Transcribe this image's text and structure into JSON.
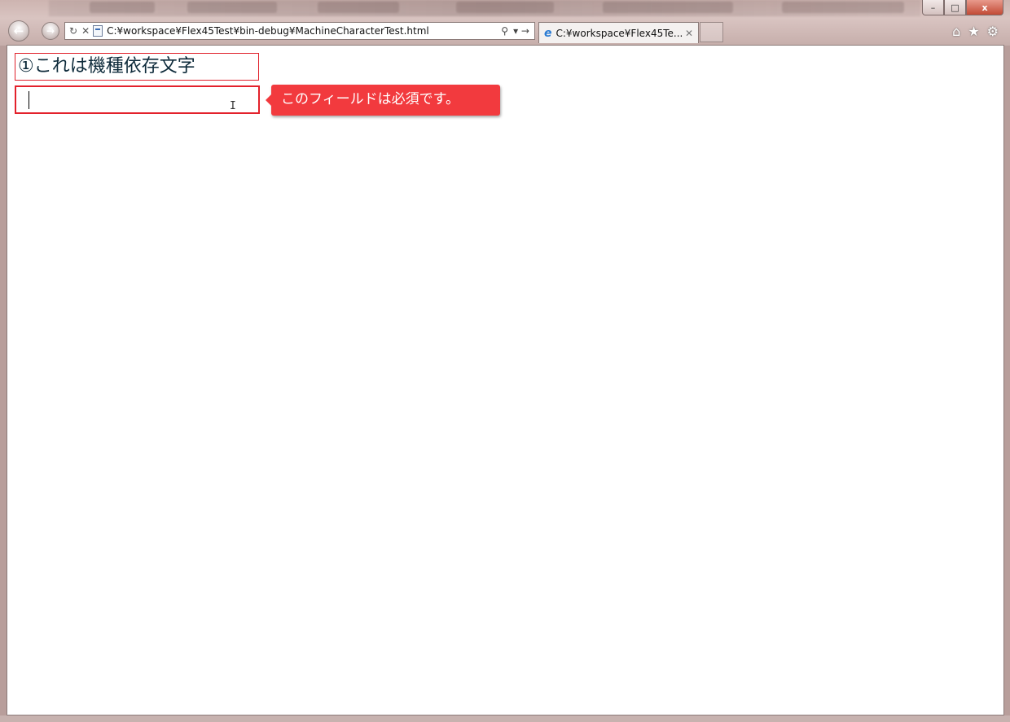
{
  "window": {
    "minimize_glyph": "–",
    "maximize_glyph": "□",
    "close_glyph": "x"
  },
  "toolbar": {
    "back_glyph": "←",
    "forward_glyph": "→",
    "refresh_glyph": "↻",
    "stop_glyph": "✕",
    "url": "C:¥workspace¥Flex45Test¥bin-debug¥MachineCharacterTest.html",
    "search_glyph": "⚲",
    "go_glyph": "▾ →"
  },
  "tab": {
    "icon_glyph": "e",
    "title": "C:¥workspace¥Flex45Te...",
    "close_glyph": "✕"
  },
  "tools": {
    "home_glyph": "⌂",
    "favorites_glyph": "★",
    "settings_glyph": "⚙"
  },
  "page": {
    "label": "①これは機種依存文字",
    "input_value": "",
    "validation_message": "このフィールドは必須です。"
  },
  "colors": {
    "error_border": "#e3212b",
    "tooltip_bg": "#f23a3e"
  }
}
